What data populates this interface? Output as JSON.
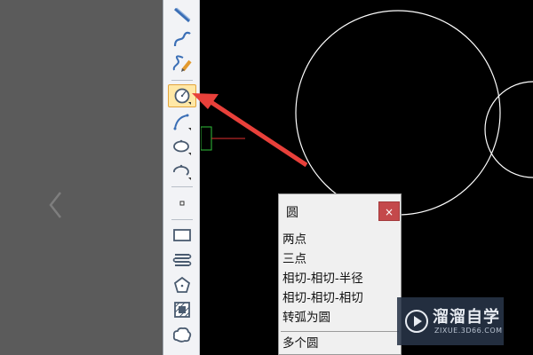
{
  "toolbar": {
    "tools": [
      {
        "name": "line-tool-icon"
      },
      {
        "name": "polyline-tool-icon"
      },
      {
        "name": "freehand-tool-icon"
      },
      {
        "name": "circle-tool-icon",
        "active": true
      },
      {
        "name": "arc-tool-icon"
      },
      {
        "name": "ellipse-tool-icon"
      },
      {
        "name": "ellipse-arc-tool-icon"
      },
      {
        "name": "point-tool-icon"
      },
      {
        "name": "rectangle-tool-icon"
      },
      {
        "name": "spring-tool-icon"
      },
      {
        "name": "polygon-tool-icon"
      },
      {
        "name": "hatch-tool-icon"
      },
      {
        "name": "cloud-tool-icon"
      }
    ]
  },
  "circle_menu": {
    "title": "圆",
    "close_label": "×",
    "items": [
      "两点",
      "三点",
      "相切-相切-半径",
      "相切-相切-相切",
      "转弧为圆"
    ],
    "last_item": "多个圆"
  },
  "watermark": {
    "name": "溜溜自学",
    "url": "ZIXUE.3D66.COM"
  },
  "colors": {
    "canvas": "#000000",
    "annotation_arrow": "#e8403a",
    "circle_stroke": "#ffffff",
    "snap_marker": "#2fbf3a"
  }
}
